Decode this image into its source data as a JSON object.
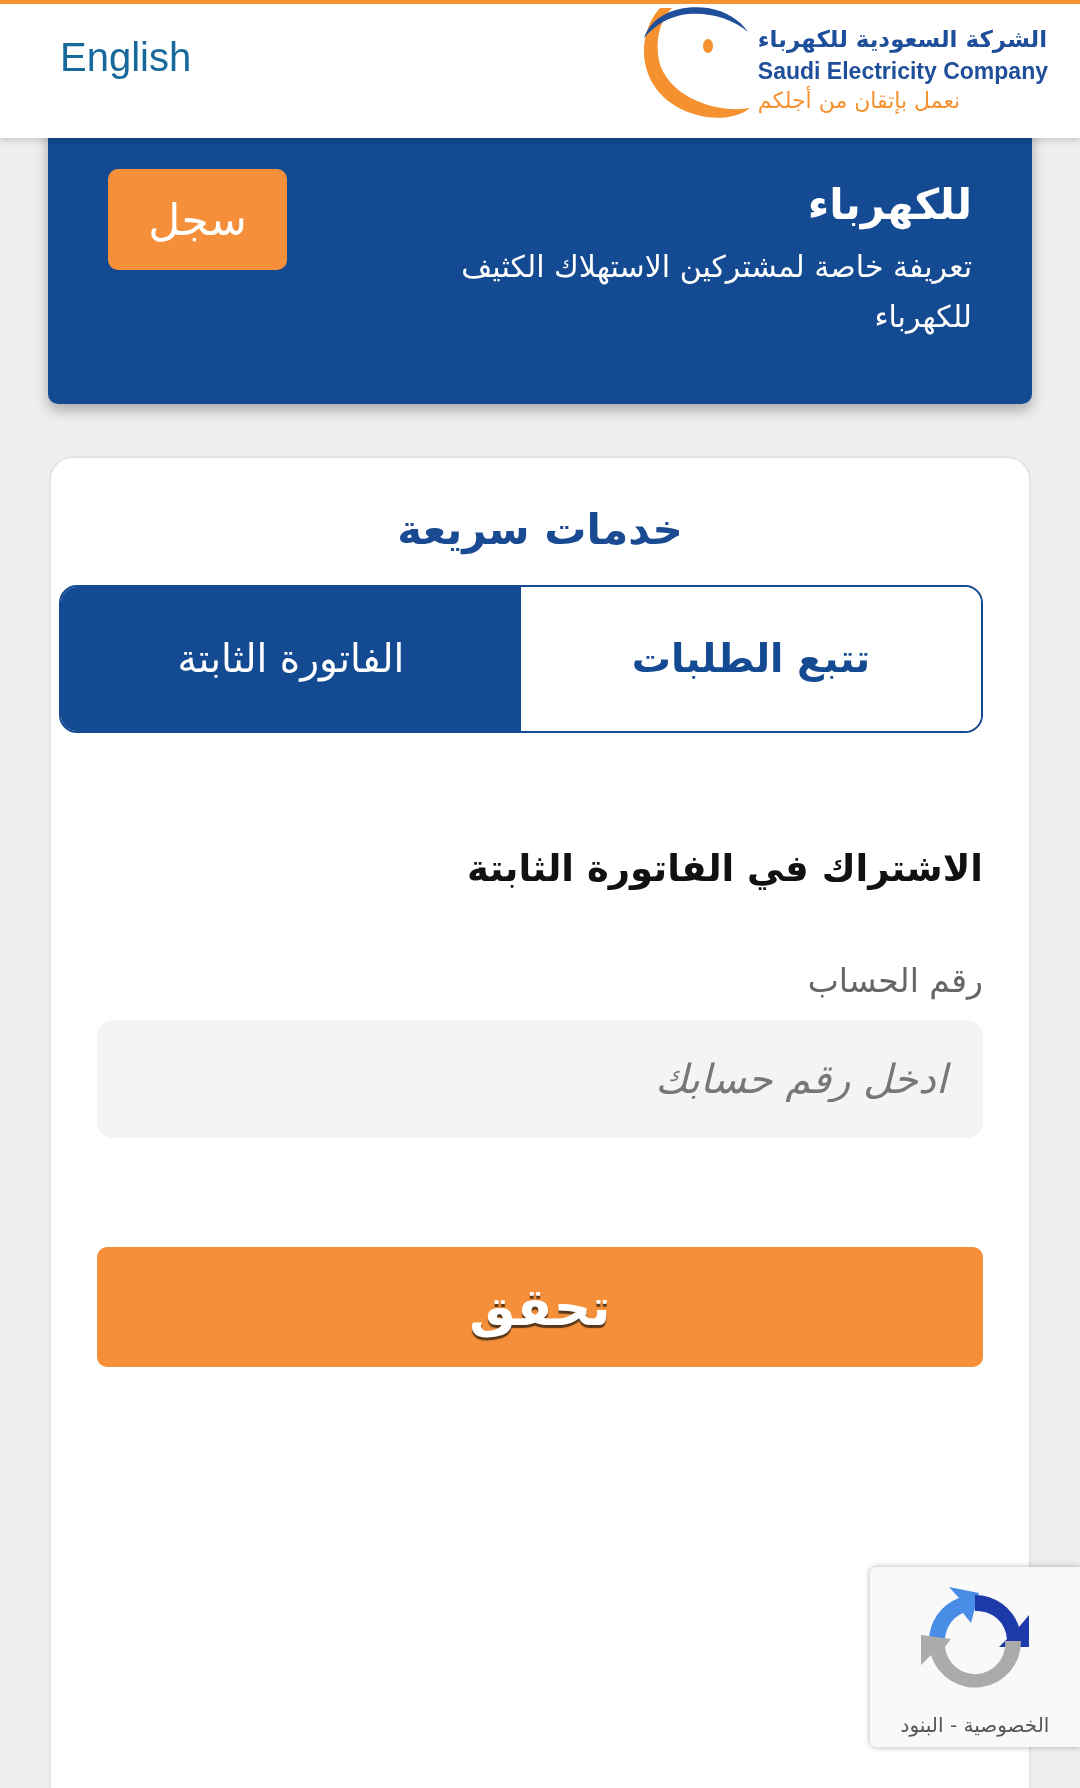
{
  "header": {
    "language_link": "English",
    "logo": {
      "name_ar": "الشركة السعودية للكهرباء",
      "name_en": "Saudi Electricity Company",
      "slogan": "نعمل بإتقان من أجلكم"
    }
  },
  "banner": {
    "title": "للكهرباء",
    "subtitle": "تعريفة خاصة لمشتركين الاستهلاك الكثيف للكهرباء",
    "button": "سجل"
  },
  "quick_services": {
    "title": "خدمات سريعة",
    "tabs": [
      {
        "label": "تتبع الطلبات",
        "selected": false
      },
      {
        "label": "الفاتورة الثابتة",
        "selected": true
      }
    ],
    "form": {
      "heading": "الاشتراك في الفاتورة الثابتة",
      "field": {
        "label": "رقم الحساب",
        "placeholder": "ادخل رقم حسابك"
      },
      "submit": "تحقق"
    }
  },
  "recaptcha": {
    "links": "الخصوصية - البنود"
  }
}
